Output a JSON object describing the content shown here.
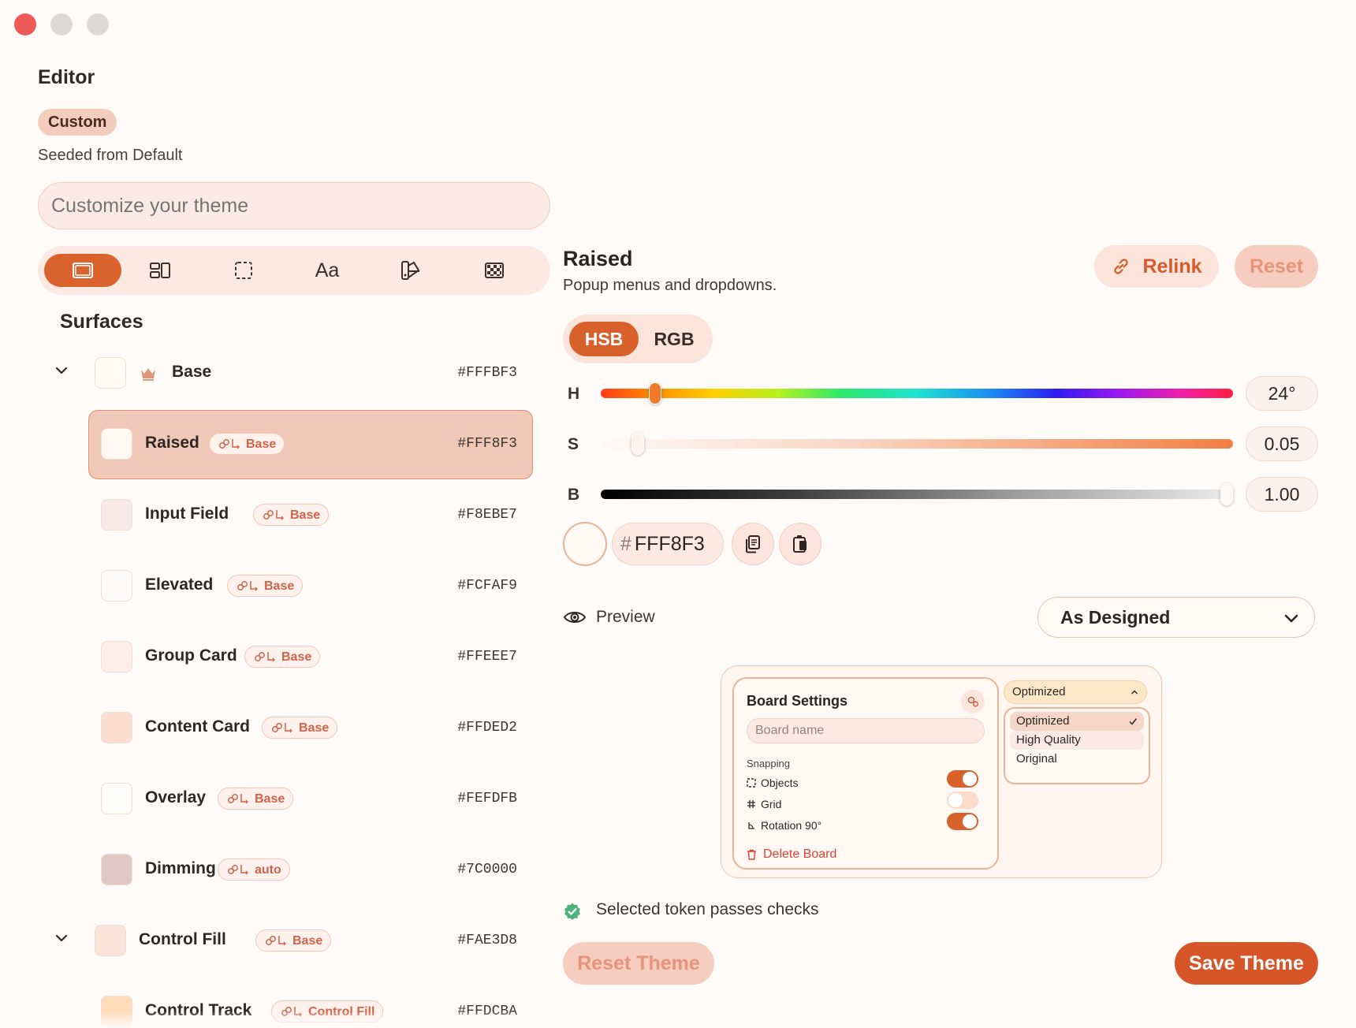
{
  "app": {
    "title": "Editor",
    "badge": "Custom",
    "seeded": "Seeded from Default"
  },
  "search": {
    "placeholder": "Customize your theme"
  },
  "toolbar": {
    "tools": [
      "surfaces",
      "layout",
      "spacing",
      "Aa",
      "palette",
      "pattern"
    ]
  },
  "section": {
    "title": "Surfaces"
  },
  "tokens": [
    {
      "name": "Base",
      "hex": "#FFFBF3",
      "link": "",
      "color": "#fffbf3",
      "expandable": true,
      "crown": true
    },
    {
      "name": "Raised",
      "hex": "#FFF8F3",
      "link": "Base",
      "color": "#fff8f3",
      "selected": true
    },
    {
      "name": "Input Field",
      "hex": "#F8EBE7",
      "link": "Base",
      "color": "#f8ebe7"
    },
    {
      "name": "Elevated",
      "hex": "#FCFAF9",
      "link": "Base",
      "color": "#fcfaf9"
    },
    {
      "name": "Group Card",
      "hex": "#FFEEE7",
      "link": "Base",
      "color": "#ffeee7"
    },
    {
      "name": "Content Card",
      "hex": "#FFDED2",
      "link": "Base",
      "color": "#ffded2"
    },
    {
      "name": "Overlay",
      "hex": "#FEFDFB",
      "link": "Base",
      "color": "#fefdfb"
    },
    {
      "name": "Dimming",
      "hex": "#7C0000",
      "link": "auto",
      "color": "#e0c8c4"
    },
    {
      "name": "Control Fill",
      "hex": "#FAE3D8",
      "link": "Base",
      "color": "#fae3d8",
      "expandable": true
    },
    {
      "name": "Control Track",
      "hex": "#FFDCBA",
      "link": "Control Fill",
      "color": "#ffdcba"
    }
  ],
  "detail": {
    "title": "Raised",
    "subtitle": "Popup menus and dropdowns.",
    "relink": "Relink",
    "reset": "Reset",
    "modes": [
      "HSB",
      "RGB"
    ],
    "sliders": [
      {
        "label": "H",
        "value": "24°",
        "fraction": 0.078
      },
      {
        "label": "S",
        "value": "0.05",
        "fraction": 0.05
      },
      {
        "label": "B",
        "value": "1.00",
        "fraction": 1.0
      }
    ],
    "hash": "#",
    "hex": "FFF8F3",
    "preview_label": "Preview",
    "preview_mode": "As Designed",
    "checks": "Selected token passes checks",
    "reset_theme": "Reset Theme",
    "save_theme": "Save Theme"
  },
  "preview": {
    "card_title": "Board Settings",
    "name_placeholder": "Board name",
    "snapping": "Snapping",
    "items": [
      {
        "label": "Objects",
        "on": true
      },
      {
        "label": "Grid",
        "on": false
      },
      {
        "label": "Rotation 90°",
        "on": true
      }
    ],
    "delete": "Delete Board",
    "select_value": "Optimized",
    "options": [
      "Optimized",
      "High Quality",
      "Original"
    ]
  },
  "colors": {
    "accent": "#D8602B",
    "link": "#D1634A",
    "danger": "#E0423A",
    "ok": "#4DB37A"
  }
}
